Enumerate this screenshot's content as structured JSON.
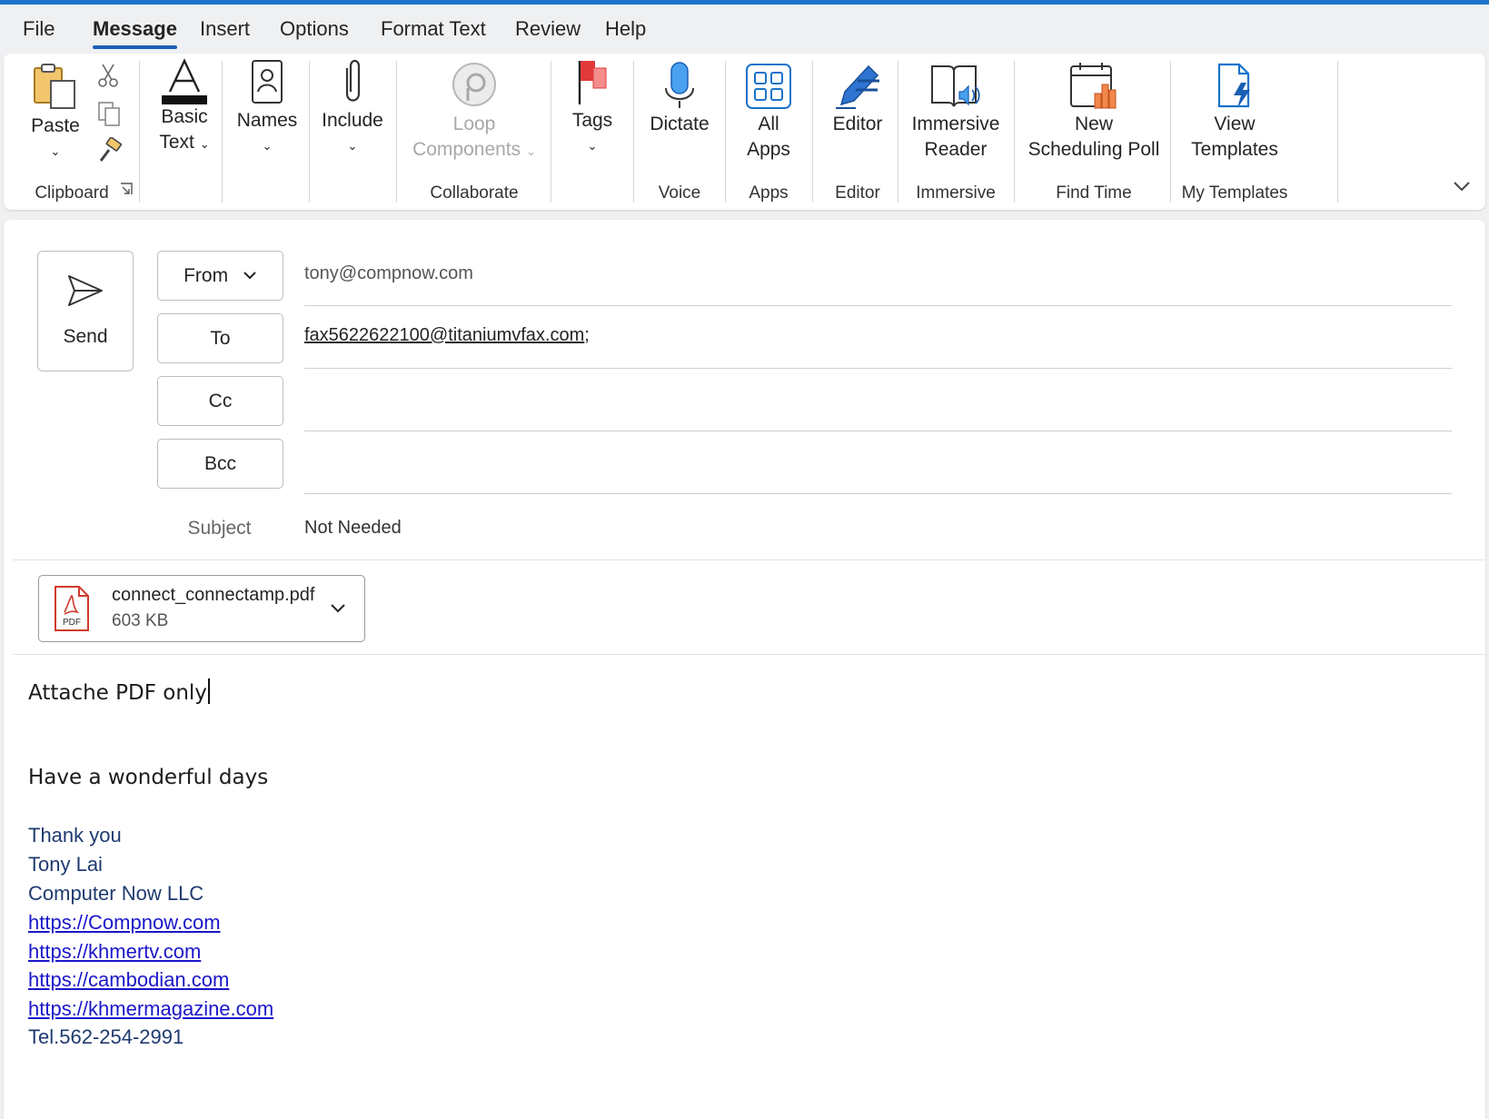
{
  "menu": {
    "tabs": [
      "File",
      "Message",
      "Insert",
      "Options",
      "Format Text",
      "Review",
      "Help"
    ],
    "active": "Message"
  },
  "ribbon": {
    "clipboard": {
      "paste": "Paste",
      "group": "Clipboard"
    },
    "basic_text": {
      "line1": "Basic",
      "line2": "Text"
    },
    "names": {
      "label": "Names"
    },
    "include": {
      "label": "Include"
    },
    "collaborate": {
      "line1": "Loop",
      "line2": "Components",
      "group": "Collaborate"
    },
    "tags": {
      "label": "Tags"
    },
    "voice": {
      "label": "Dictate",
      "group": "Voice"
    },
    "apps": {
      "line1": "All",
      "line2": "Apps",
      "group": "Apps"
    },
    "editor": {
      "label": "Editor",
      "group": "Editor"
    },
    "immersive": {
      "line1": "Immersive",
      "line2": "Reader",
      "group": "Immersive"
    },
    "find_time": {
      "line1": "New",
      "line2": "Scheduling Poll",
      "group": "Find Time"
    },
    "my_templates": {
      "line1": "View",
      "line2": "Templates",
      "group": "My Templates"
    },
    "accent_color": "#1a5fb4"
  },
  "compose": {
    "send_label": "Send",
    "from_label": "From",
    "from_value": "tony@compnow.com",
    "to_label": "To",
    "to_value": "fax5622622100@titaniumvfax.com",
    "to_separator": ";",
    "cc_label": "Cc",
    "bcc_label": "Bcc",
    "subject_label": "Subject",
    "subject_value": "Not Needed"
  },
  "attachment": {
    "filename": "connect_connectamp.pdf",
    "size": "603 KB",
    "type_badge": "PDF"
  },
  "body": {
    "line1": "Attache PDF only",
    "line2": "Have a wonderful days",
    "signature": {
      "thanks": "Thank you",
      "name": "Tony Lai",
      "company": "Computer Now LLC",
      "links": [
        "https://Compnow.com",
        "https://khmertv.com",
        "https://cambodian.com",
        "https://khmermagazine.com"
      ],
      "tel": "Tel.562-254-2991"
    }
  }
}
